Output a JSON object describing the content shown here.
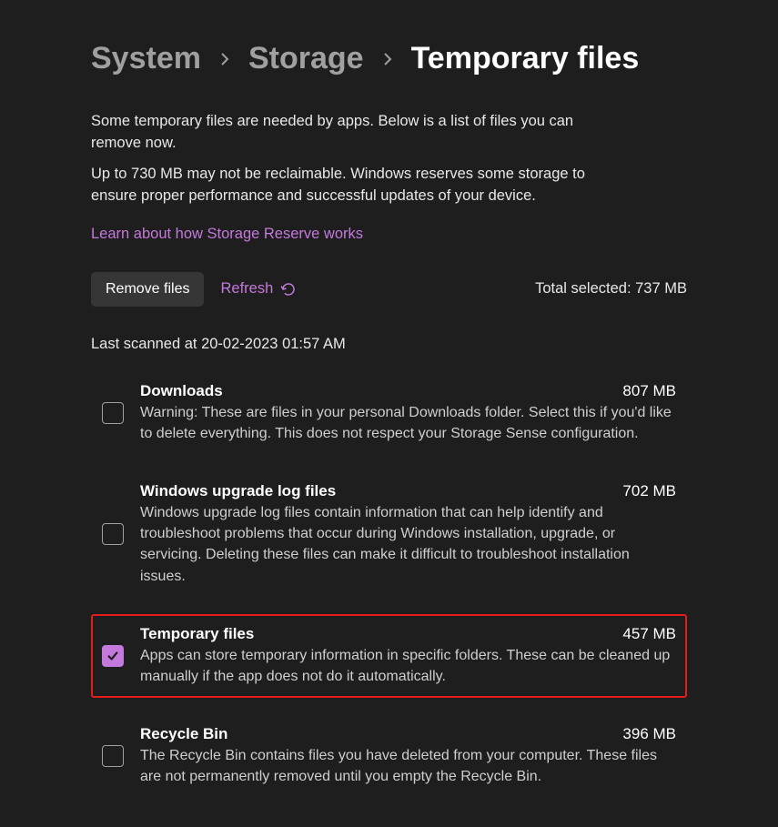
{
  "breadcrumb": {
    "items": [
      "System",
      "Storage",
      "Temporary files"
    ]
  },
  "descriptions": {
    "intro": "Some temporary files are needed by apps. Below is a list of files you can remove now.",
    "reserve": "Up to 730 MB may not be reclaimable. Windows reserves some storage to ensure proper performance and successful updates of your device.",
    "link": "Learn about how Storage Reserve works"
  },
  "actions": {
    "remove": "Remove files",
    "refresh": "Refresh",
    "total_label": "Total selected: ",
    "total_value": "737 MB"
  },
  "last_scanned": "Last scanned at 20-02-2023 01:57 AM",
  "items": [
    {
      "title": "Downloads",
      "size": "807 MB",
      "description": "Warning: These are files in your personal Downloads folder. Select this if you'd like to delete everything. This does not respect your Storage Sense configuration.",
      "checked": false,
      "highlighted": false
    },
    {
      "title": "Windows upgrade log files",
      "size": "702 MB",
      "description": "Windows upgrade log files contain information that can help identify and troubleshoot problems that occur during Windows installation, upgrade, or servicing.  Deleting these files can make it difficult to troubleshoot installation issues.",
      "checked": false,
      "highlighted": false
    },
    {
      "title": "Temporary files",
      "size": "457 MB",
      "description": "Apps can store temporary information in specific folders. These can be cleaned up manually if the app does not do it automatically.",
      "checked": true,
      "highlighted": true
    },
    {
      "title": "Recycle Bin",
      "size": "396 MB",
      "description": "The Recycle Bin contains files you have deleted from your computer. These files are not permanently removed until you empty the Recycle Bin.",
      "checked": false,
      "highlighted": false
    }
  ]
}
